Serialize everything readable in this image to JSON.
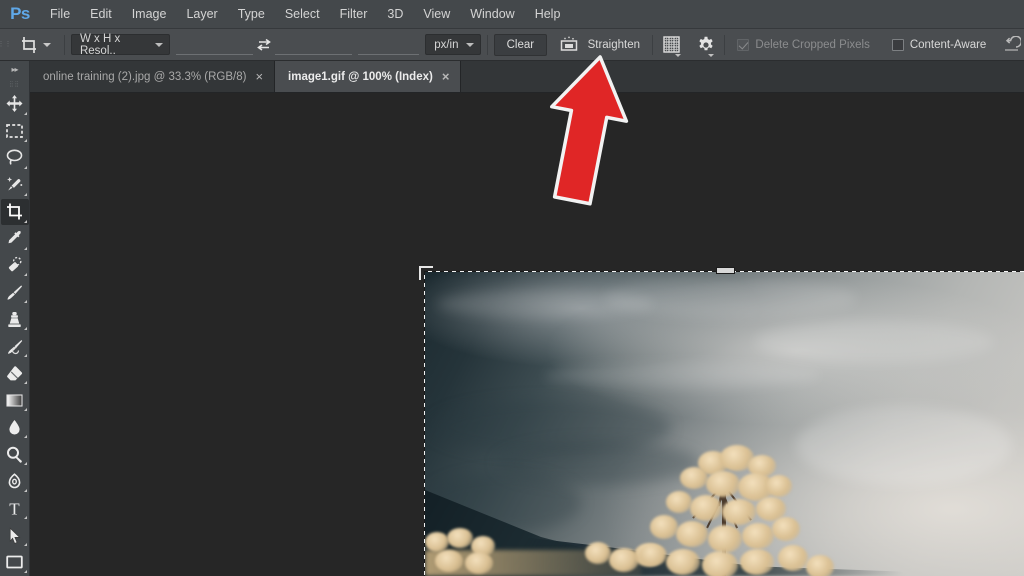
{
  "app": {
    "name": "Adobe Photoshop",
    "logo_text": "Ps",
    "accent_color": "#5fa8e8",
    "ui_bg": "#44484b",
    "canvas_bg": "#262626"
  },
  "menubar": {
    "items": [
      {
        "label": "File"
      },
      {
        "label": "Edit"
      },
      {
        "label": "Image"
      },
      {
        "label": "Layer"
      },
      {
        "label": "Type"
      },
      {
        "label": "Select"
      },
      {
        "label": "Filter"
      },
      {
        "label": "3D"
      },
      {
        "label": "View"
      },
      {
        "label": "Window"
      },
      {
        "label": "Help"
      }
    ]
  },
  "options_bar": {
    "tool_preset_icon": "crop-tool-icon",
    "ratio_select": {
      "value": "W x H x Resol..",
      "icon": "chevron-down-icon"
    },
    "width_field": {
      "value": "",
      "placeholder": ""
    },
    "swap_icon": "swap-width-height-icon",
    "height_field": {
      "value": "",
      "placeholder": ""
    },
    "resolution_field": {
      "value": "",
      "placeholder": ""
    },
    "unit_select": {
      "value": "px/in",
      "icon": "chevron-down-icon"
    },
    "clear_button": "Clear",
    "straighten_icon": "straighten-icon",
    "straighten_button": "Straighten",
    "overlay_icon": "crop-overlay-grid-icon",
    "settings_icon": "gear-icon",
    "delete_cropped_pixels": {
      "label": "Delete Cropped Pixels",
      "checked": true,
      "enabled": false
    },
    "content_aware": {
      "label": "Content-Aware",
      "checked": false,
      "enabled": true
    },
    "reset_icon": "reset-tool-icon"
  },
  "tabs": [
    {
      "label": "online training (2).jpg @ 33.3% (RGB/8)",
      "active": false,
      "close": "×"
    },
    {
      "label": "image1.gif @ 100% (Index)",
      "active": true,
      "close": "×"
    }
  ],
  "toolbar": {
    "expand_icon": "double-chevron-right-icon",
    "grip_icon": "panel-drag-handle-icon",
    "tools": [
      {
        "name": "move-tool",
        "icon": "move-icon",
        "selected": false,
        "has_flyout": true
      },
      {
        "name": "rectangular-marquee-tool",
        "icon": "marquee-icon",
        "selected": false,
        "has_flyout": true
      },
      {
        "name": "lasso-tool",
        "icon": "lasso-icon",
        "selected": false,
        "has_flyout": true
      },
      {
        "name": "quick-selection-tool",
        "icon": "magic-wand-icon",
        "selected": false,
        "has_flyout": true
      },
      {
        "name": "crop-tool",
        "icon": "crop-icon",
        "selected": true,
        "has_flyout": true
      },
      {
        "name": "eyedropper-tool",
        "icon": "eyedropper-icon",
        "selected": false,
        "has_flyout": true
      },
      {
        "name": "spot-healing-brush-tool",
        "icon": "healing-brush-icon",
        "selected": false,
        "has_flyout": true
      },
      {
        "name": "brush-tool",
        "icon": "brush-icon",
        "selected": false,
        "has_flyout": true
      },
      {
        "name": "clone-stamp-tool",
        "icon": "clone-stamp-icon",
        "selected": false,
        "has_flyout": true
      },
      {
        "name": "history-brush-tool",
        "icon": "history-brush-icon",
        "selected": false,
        "has_flyout": true
      },
      {
        "name": "eraser-tool",
        "icon": "eraser-icon",
        "selected": false,
        "has_flyout": true
      },
      {
        "name": "gradient-tool",
        "icon": "gradient-icon",
        "selected": false,
        "has_flyout": true
      },
      {
        "name": "blur-tool",
        "icon": "blur-droplet-icon",
        "selected": false,
        "has_flyout": true
      },
      {
        "name": "dodge-tool",
        "icon": "dodge-icon",
        "selected": false,
        "has_flyout": true
      },
      {
        "name": "pen-tool",
        "icon": "pen-icon",
        "selected": false,
        "has_flyout": true
      },
      {
        "name": "type-tool",
        "icon": "type-t-icon",
        "selected": false,
        "has_flyout": true
      },
      {
        "name": "path-selection-tool",
        "icon": "path-arrow-icon",
        "selected": false,
        "has_flyout": true
      },
      {
        "name": "rectangle-tool",
        "icon": "rectangle-shape-icon",
        "selected": false,
        "has_flyout": true
      }
    ]
  },
  "canvas": {
    "document_name": "image1.gif",
    "zoom_level": "100%",
    "color_mode": "Index",
    "crop_active": true,
    "crop_handles": [
      "top-left-corner",
      "top-center"
    ],
    "photo_description": "Overcast grey storm clouds over a dark mountain ridge with a golden blossoming tree in the foreground"
  },
  "annotation": {
    "arrow": {
      "name": "red-arrow-pointer",
      "color": "#e02626",
      "outline_color": "#f0f0f0",
      "points_at": "Straighten"
    }
  }
}
